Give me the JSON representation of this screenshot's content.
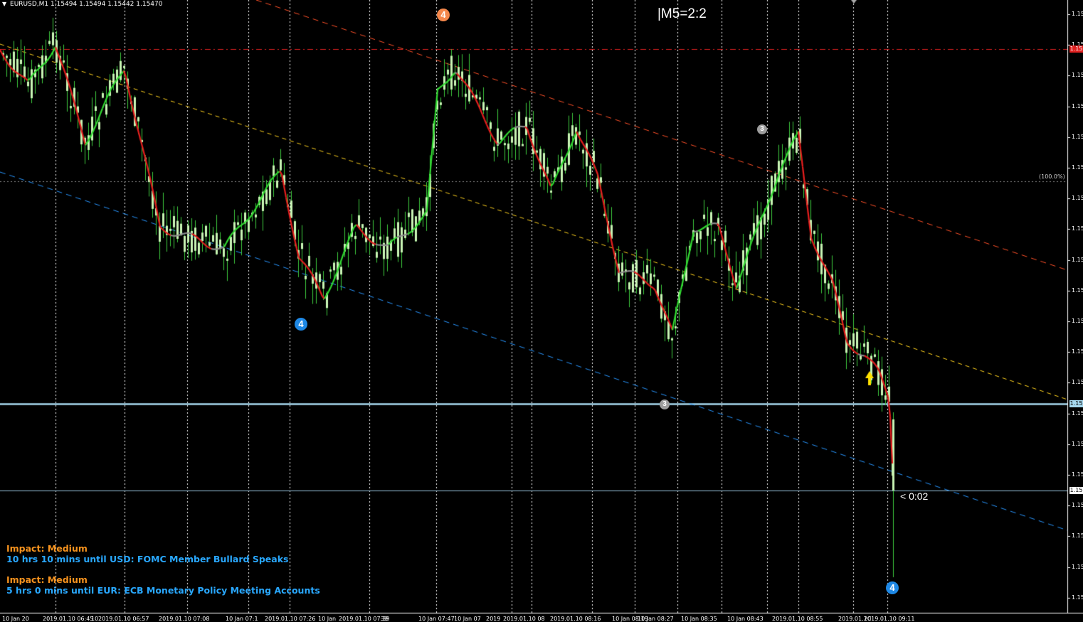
{
  "header": {
    "symbol": "EURUSD,M1",
    "ohlc": "1.15494 1.15494 1.15442 1.15470"
  },
  "overlay_label": "|M5=2:2",
  "countdown": "< 0:02",
  "fib_label": "(100.0%)",
  "price_labels": [
    "1.15",
    "1.15",
    "1.15",
    "1.15",
    "1.15",
    "1.15",
    "1.15",
    "1.15",
    "1.15",
    "1.15",
    "1.15",
    "1.15",
    "1.15",
    "1.15",
    "1.15",
    "1.15",
    "1.15",
    "1.15",
    "1.15",
    "1.15"
  ],
  "price_tags": {
    "red": "1.15",
    "cyan": "1.15",
    "white": "1.15"
  },
  "time_labels": [
    "10 Jan 20",
    "2019.01.10 06:45",
    "10",
    "2019.01.10 06:57",
    "2019.01.10 07:08",
    "10 Jan 07:1",
    "2019.01.10 07:26",
    "10 Jan",
    "2019.01.10 07:39",
    "39",
    "10 Jan 07:47",
    "10 Jan 07",
    "2019",
    "2019.01.10 08",
    "2019.01.10 08:16",
    "10 Jan 08:19",
    "10 Jan 08:27",
    "10 Jan 08:35",
    "10 Jan 08:43",
    "2019.01.10 08:55",
    "2019.01.1C",
    "2019.01.10 09:11"
  ],
  "wave_markers": [
    {
      "label": "4",
      "color": "#f4874b"
    },
    {
      "label": "4",
      "color": "#1e88e5"
    },
    {
      "label": "3",
      "color": "#9e9e9e"
    },
    {
      "label": "3",
      "color": "#9e9e9e"
    },
    {
      "label": "4",
      "color": "#1e88e5"
    }
  ],
  "news": [
    {
      "impact": "Impact: Medium",
      "event": "10 hrs 10 mins until USD: FOMC Member Bullard Speaks"
    },
    {
      "impact": "Impact: Medium",
      "event": "5 hrs 0 mins until EUR: ECB Monetary Policy Meeting Accounts"
    }
  ],
  "colors": {
    "background": "#000000",
    "candle": "#c8f5b4",
    "wick": "#3cc83c",
    "ma_up": "#32dc32",
    "ma_down": "#e61e1e",
    "ma_flat": "#8c8c8c",
    "channel_upper": "#ff5028",
    "channel_mid": "#ffd21e",
    "channel_lower": "#2896ff",
    "hline_red": "#e02020",
    "hline_cyan": "#a6d8ee"
  }
}
